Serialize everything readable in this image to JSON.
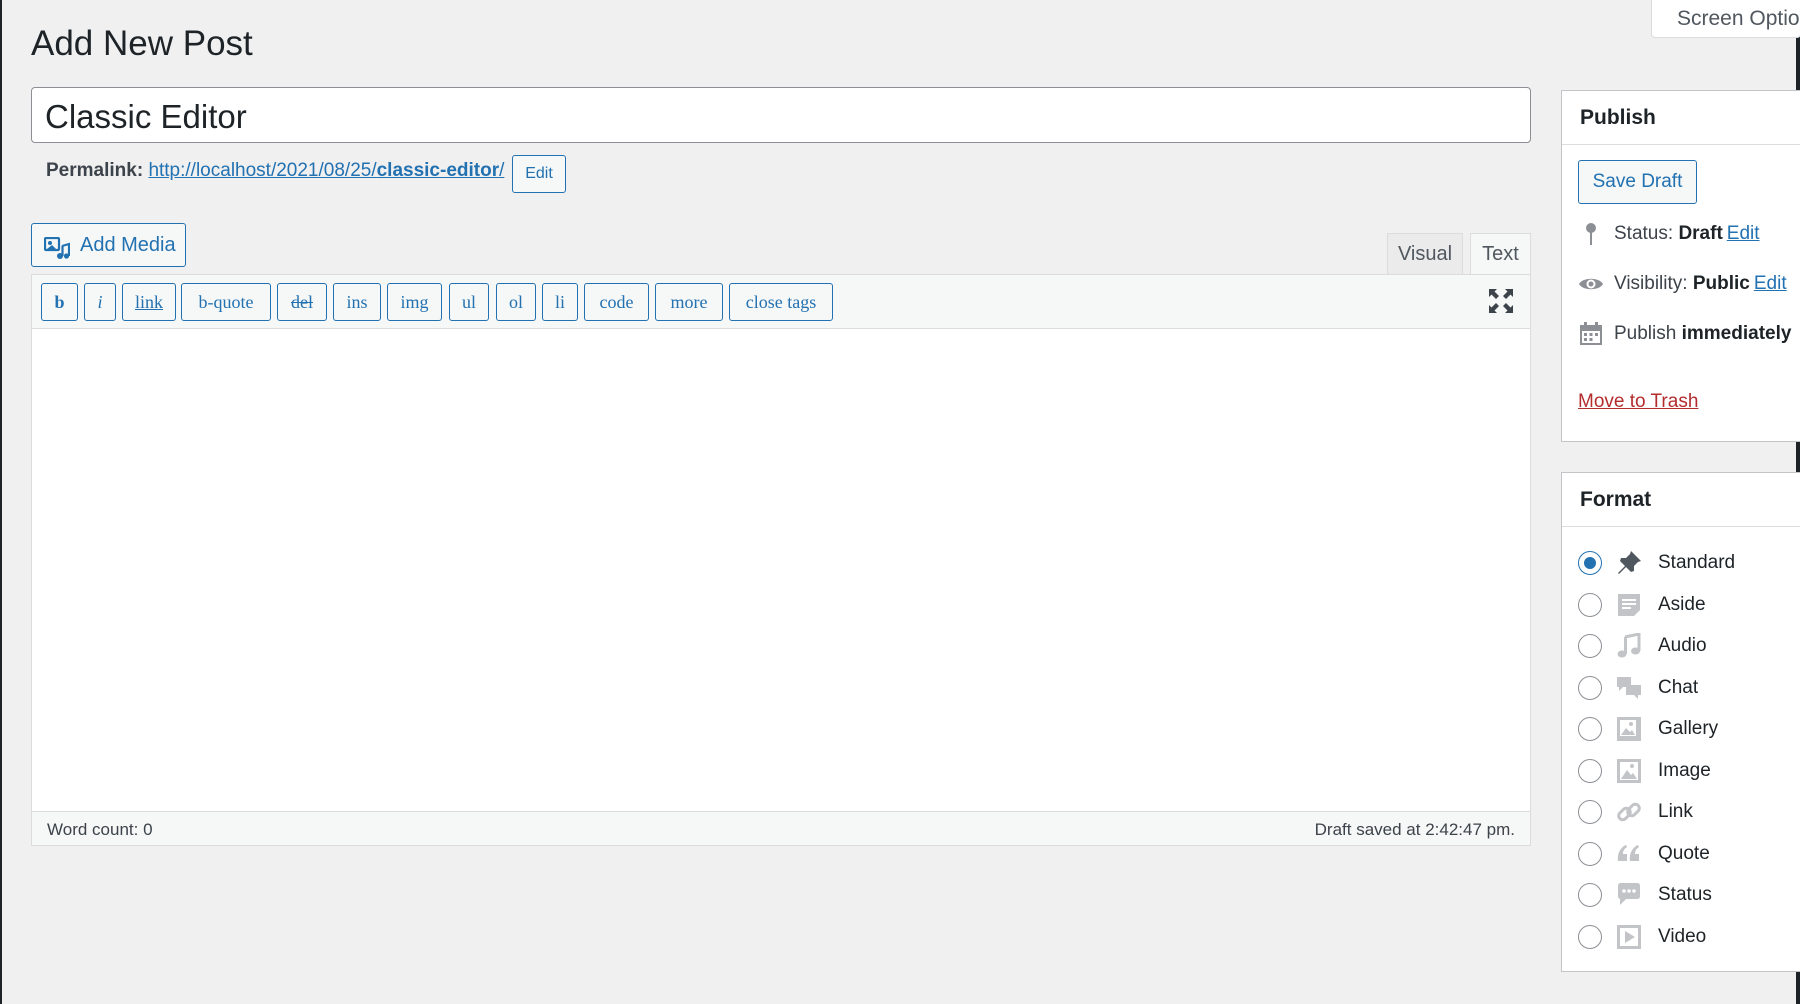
{
  "header": {
    "title": "Add New Post",
    "screen_options_label": "Screen Options"
  },
  "post": {
    "title": "Classic Editor",
    "permalink": {
      "label": "Permalink:",
      "base_url": "http://localhost/2021/08/25/",
      "slug": "classic-editor",
      "trailing_slash": "/",
      "edit_label": "Edit"
    }
  },
  "editor": {
    "add_media_label": "Add Media",
    "tabs": [
      "Visual",
      "Text"
    ],
    "active_tab": "Text",
    "quicktags": [
      "b",
      "i",
      "link",
      "b-quote",
      "del",
      "ins",
      "img",
      "ul",
      "ol",
      "li",
      "code",
      "more",
      "close tags"
    ],
    "word_count": "Word count: 0",
    "draft_saved": "Draft saved at 2:42:47 pm."
  },
  "publish_box": {
    "title": "Publish",
    "save_draft_label": "Save Draft",
    "status_label": "Status:",
    "status_value": "Draft",
    "visibility_label": "Visibility:",
    "visibility_value": "Public",
    "publish_label": "Publish",
    "publish_value": "immediately",
    "edit_link": "Edit",
    "trash_label": "Move to Trash"
  },
  "format_box": {
    "title": "Format",
    "selected": "Standard",
    "options": [
      {
        "label": "Standard",
        "icon": "pushpin-icon"
      },
      {
        "label": "Aside",
        "icon": "aside-icon"
      },
      {
        "label": "Audio",
        "icon": "music-note-icon"
      },
      {
        "label": "Chat",
        "icon": "chat-bubbles-icon"
      },
      {
        "label": "Gallery",
        "icon": "gallery-icon"
      },
      {
        "label": "Image",
        "icon": "image-icon"
      },
      {
        "label": "Link",
        "icon": "chain-link-icon"
      },
      {
        "label": "Quote",
        "icon": "quote-icon"
      },
      {
        "label": "Status",
        "icon": "status-bubble-icon"
      },
      {
        "label": "Video",
        "icon": "video-icon"
      }
    ]
  },
  "colors": {
    "accent": "#2271b1",
    "danger": "#b32d2e",
    "background": "#f0f0f1"
  }
}
